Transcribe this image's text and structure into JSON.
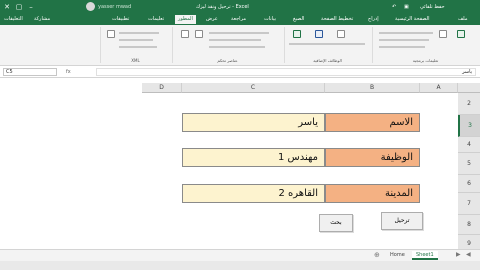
{
  "titlebar": {
    "doc_title": "ترحيل ونقد ليزك - Excel",
    "user_name": "yasser mwad",
    "search_hint": "حفظ تلقائي"
  },
  "tabs": [
    {
      "label": "تطبيقات"
    },
    {
      "label": "تعليمات"
    },
    {
      "label": "المطور"
    },
    {
      "label": "عرض"
    },
    {
      "label": "مراجعة"
    },
    {
      "label": "بيانات"
    },
    {
      "label": "الصيغ"
    },
    {
      "label": "تخطيط الصفحة"
    },
    {
      "label": "إدراج"
    },
    {
      "label": "الصفحة الرئيسية"
    },
    {
      "label": "ملف"
    }
  ],
  "ribbon_actions": {
    "share": "مشاركة",
    "comments": "التعليقات"
  },
  "ribbon_groups": {
    "code": "تعليمات برمجية",
    "addins": "الوظائف الإضافية",
    "controls": "عناصر تحكم",
    "xml": "XML"
  },
  "formula": {
    "name_box": "C5",
    "fx": "fx",
    "value": "ياسر"
  },
  "columns": [
    "A",
    "B",
    "C",
    "D"
  ],
  "rows": [
    "2",
    "3",
    "4",
    "5",
    "6",
    "7",
    "8",
    "9"
  ],
  "form": {
    "name_label": "الاسم",
    "name_value": "ياسر",
    "job_label": "الوظيفة",
    "job_value": "مهندس 1",
    "city_label": "المدينة",
    "city_value": "القاهره 2"
  },
  "buttons": {
    "post": "ترحيل",
    "search": "بحث"
  },
  "sheets": [
    {
      "name": "Sheet1",
      "active": true
    },
    {
      "name": "Home",
      "active": false
    }
  ],
  "colors": {
    "excel_green": "#217346",
    "label_fill": "#f4b183",
    "value_fill": "#fdf3cf"
  }
}
